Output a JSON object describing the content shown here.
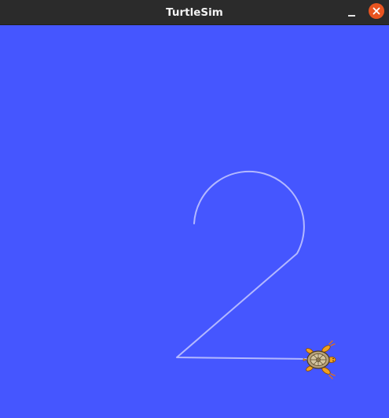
{
  "window": {
    "title": "TurtleSim"
  },
  "titlebar": {
    "minimize_icon": "minimize-icon",
    "close_icon": "close-icon",
    "close_color": "#e95420"
  },
  "canvas": {
    "background_color": "#4556ff",
    "pen_color": "#b3b8ff",
    "drawn_shape": "digit-2-path",
    "turtle_icon": "turtle-icon"
  }
}
